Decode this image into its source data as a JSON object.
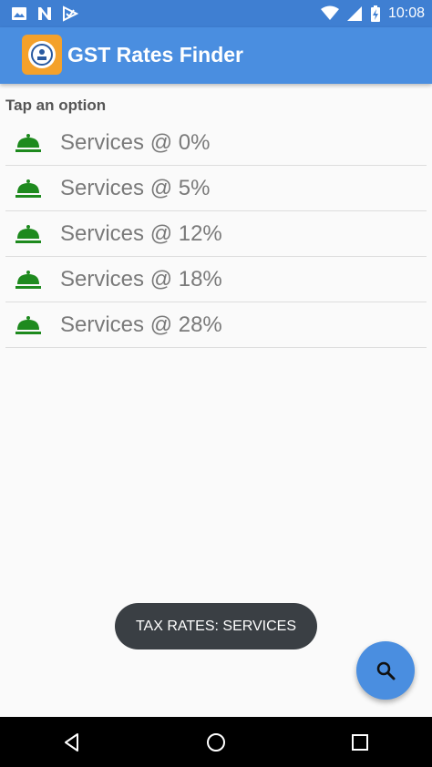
{
  "status_bar": {
    "time": "10:08",
    "left_icons": [
      "image-icon",
      "n-icon",
      "play-check-icon"
    ],
    "right_icons": [
      "wifi-icon",
      "signal-icon",
      "battery-charging-icon"
    ]
  },
  "app_bar": {
    "title": "GST Rates Finder",
    "logo": "emblem-logo"
  },
  "prompt": "Tap an option",
  "items": [
    {
      "label": "Services @ 0%",
      "icon": "cloche-icon"
    },
    {
      "label": "Services @ 5%",
      "icon": "cloche-icon"
    },
    {
      "label": "Services @ 12%",
      "icon": "cloche-icon"
    },
    {
      "label": "Services @ 18%",
      "icon": "cloche-icon"
    },
    {
      "label": "Services @ 28%",
      "icon": "cloche-icon"
    }
  ],
  "toast": "TAX RATES: SERVICES",
  "fab": {
    "icon": "search-icon"
  },
  "nav_bar": {
    "icons": [
      "back-icon",
      "home-icon",
      "recents-icon"
    ]
  },
  "colors": {
    "status_bar": "#3f7fd2",
    "app_bar": "#4a8ee0",
    "logo_bg": "#f4a12b",
    "icon_green": "#1e8a1e",
    "toast_bg": "#3a3f44"
  }
}
